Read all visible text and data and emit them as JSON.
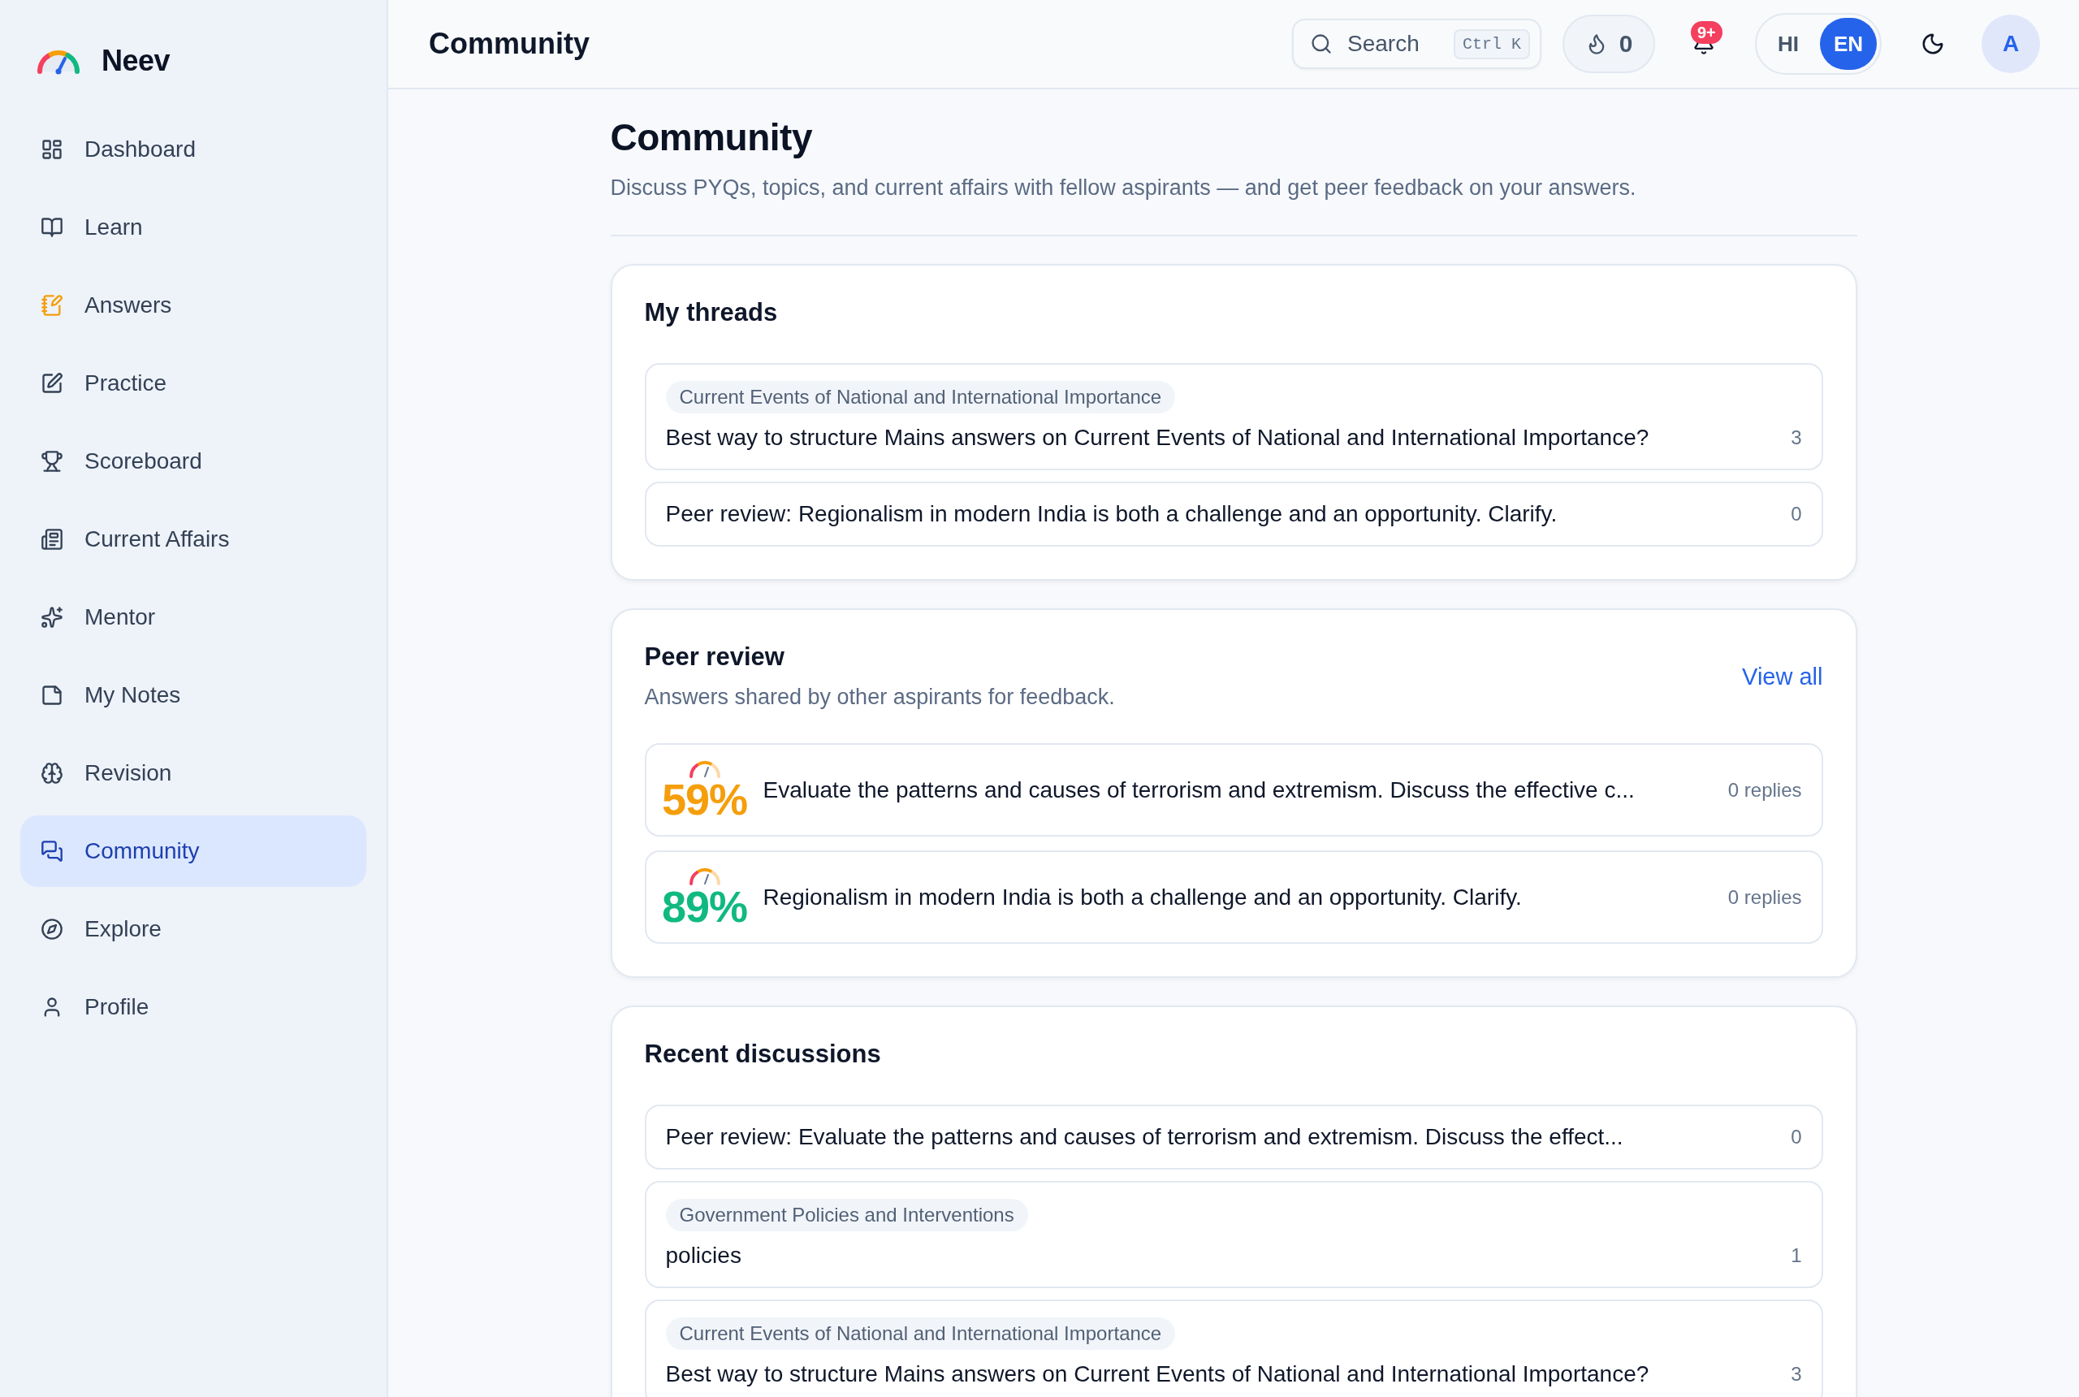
{
  "sidebar": {
    "brand": "Neev",
    "items": [
      {
        "label": "Dashboard",
        "selected": false
      },
      {
        "label": "Learn",
        "selected": false
      },
      {
        "label": "Answers",
        "selected": false
      },
      {
        "label": "Practice",
        "selected": false
      },
      {
        "label": "Scoreboard",
        "selected": false
      },
      {
        "label": "Current Affairs",
        "selected": false
      },
      {
        "label": "Mentor",
        "selected": false
      },
      {
        "label": "My Notes",
        "selected": false
      },
      {
        "label": "Revision",
        "selected": false
      },
      {
        "label": "Community",
        "selected": true
      },
      {
        "label": "Explore",
        "selected": false
      },
      {
        "label": "Profile",
        "selected": false
      }
    ]
  },
  "topbar": {
    "title": "Community",
    "search": {
      "label": "Search",
      "shortcut": "Ctrl K"
    },
    "streak": "0",
    "notifications_badge": "9+",
    "languages": [
      {
        "label": "HI",
        "selected": false
      },
      {
        "label": "EN",
        "selected": true
      }
    ],
    "avatar": "A"
  },
  "page": {
    "title": "Community",
    "subtitle": "Discuss PYQs, topics, and current affairs with fellow aspirants — and get peer feedback on your answers."
  },
  "my_threads": {
    "title": "My threads",
    "threads": [
      {
        "tag": "Current Events of National and International Importance",
        "title": "Best way to structure Mains answers on Current Events of National and International Importance?",
        "count": "3"
      },
      {
        "title": "Peer review: Regionalism in modern India is both a challenge and an opportunity. Clarify.",
        "count": "0"
      }
    ]
  },
  "peer_review": {
    "title": "Peer review",
    "subtitle": "Answers shared by other aspirants for feedback.",
    "link": "View all",
    "items": [
      {
        "score": "59%",
        "color": "#f59e0b",
        "question": "Evaluate the patterns and causes of terrorism and extremism. Discuss the effective c...",
        "replies": "0 replies"
      },
      {
        "score": "89%",
        "color": "#10b981",
        "question": "Regionalism in modern India is both a challenge and an opportunity. Clarify.",
        "replies": "0 replies"
      }
    ]
  },
  "recent_discussions": {
    "title": "Recent discussions",
    "threads": [
      {
        "title": "Peer review: Evaluate the patterns and causes of terrorism and extremism. Discuss the effect...",
        "count": "0"
      },
      {
        "tag": "Government Policies and Interventions",
        "title": "policies",
        "count": "1"
      },
      {
        "tag": "Current Events of National and International Importance",
        "title": "Best way to structure Mains answers on Current Events of National and International Importance?",
        "count": "3"
      }
    ]
  }
}
